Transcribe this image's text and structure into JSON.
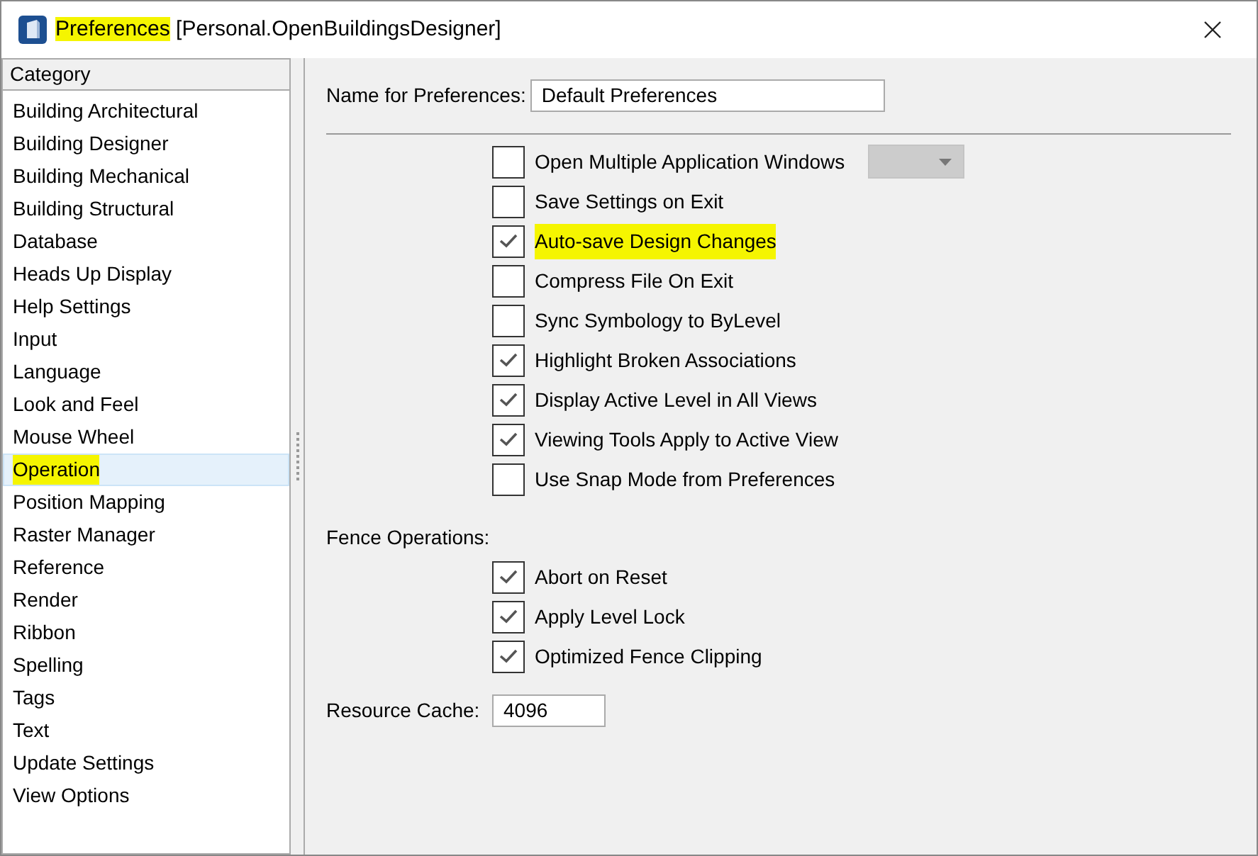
{
  "window": {
    "title": "Preferences",
    "title_highlighted": true,
    "profile": "[Personal.OpenBuildingsDesigner]"
  },
  "sidebar": {
    "header": "Category",
    "items": [
      {
        "label": "Building Architectural",
        "selected": false,
        "highlighted": false
      },
      {
        "label": "Building Designer",
        "selected": false,
        "highlighted": false
      },
      {
        "label": "Building Mechanical",
        "selected": false,
        "highlighted": false
      },
      {
        "label": "Building Structural",
        "selected": false,
        "highlighted": false
      },
      {
        "label": "Database",
        "selected": false,
        "highlighted": false
      },
      {
        "label": "Heads Up Display",
        "selected": false,
        "highlighted": false
      },
      {
        "label": "Help Settings",
        "selected": false,
        "highlighted": false
      },
      {
        "label": "Input",
        "selected": false,
        "highlighted": false
      },
      {
        "label": "Language",
        "selected": false,
        "highlighted": false
      },
      {
        "label": "Look and Feel",
        "selected": false,
        "highlighted": false
      },
      {
        "label": "Mouse Wheel",
        "selected": false,
        "highlighted": false
      },
      {
        "label": "Operation",
        "selected": true,
        "highlighted": true
      },
      {
        "label": "Position Mapping",
        "selected": false,
        "highlighted": false
      },
      {
        "label": "Raster Manager",
        "selected": false,
        "highlighted": false
      },
      {
        "label": "Reference",
        "selected": false,
        "highlighted": false
      },
      {
        "label": "Render",
        "selected": false,
        "highlighted": false
      },
      {
        "label": "Ribbon",
        "selected": false,
        "highlighted": false
      },
      {
        "label": "Spelling",
        "selected": false,
        "highlighted": false
      },
      {
        "label": "Tags",
        "selected": false,
        "highlighted": false
      },
      {
        "label": "Text",
        "selected": false,
        "highlighted": false
      },
      {
        "label": "Update Settings",
        "selected": false,
        "highlighted": false
      },
      {
        "label": "View Options",
        "selected": false,
        "highlighted": false
      }
    ]
  },
  "name_field": {
    "label": "Name for Preferences:",
    "value": "Default Preferences"
  },
  "options": [
    {
      "label": "Open Multiple Application Windows",
      "checked": false,
      "highlighted": false,
      "dropdown": {
        "disabled": true
      }
    },
    {
      "label": "Save Settings on Exit",
      "checked": false,
      "highlighted": false
    },
    {
      "label": "Auto-save Design Changes",
      "checked": true,
      "highlighted": true
    },
    {
      "label": "Compress File On Exit",
      "checked": false,
      "highlighted": false
    },
    {
      "label": "Sync Symbology to ByLevel",
      "checked": false,
      "highlighted": false
    },
    {
      "label": "Highlight Broken Associations",
      "checked": true,
      "highlighted": false
    },
    {
      "label": "Display Active Level in All Views",
      "checked": true,
      "highlighted": false
    },
    {
      "label": "Viewing Tools Apply to Active View",
      "checked": true,
      "highlighted": false
    },
    {
      "label": "Use Snap Mode from Preferences",
      "checked": false,
      "highlighted": false
    }
  ],
  "fence": {
    "label": "Fence Operations:",
    "options": [
      {
        "label": "Abort on Reset",
        "checked": true
      },
      {
        "label": "Apply Level Lock",
        "checked": true
      },
      {
        "label": "Optimized Fence Clipping",
        "checked": true
      }
    ]
  },
  "resource_cache": {
    "label": "Resource Cache:",
    "value": "4096"
  }
}
